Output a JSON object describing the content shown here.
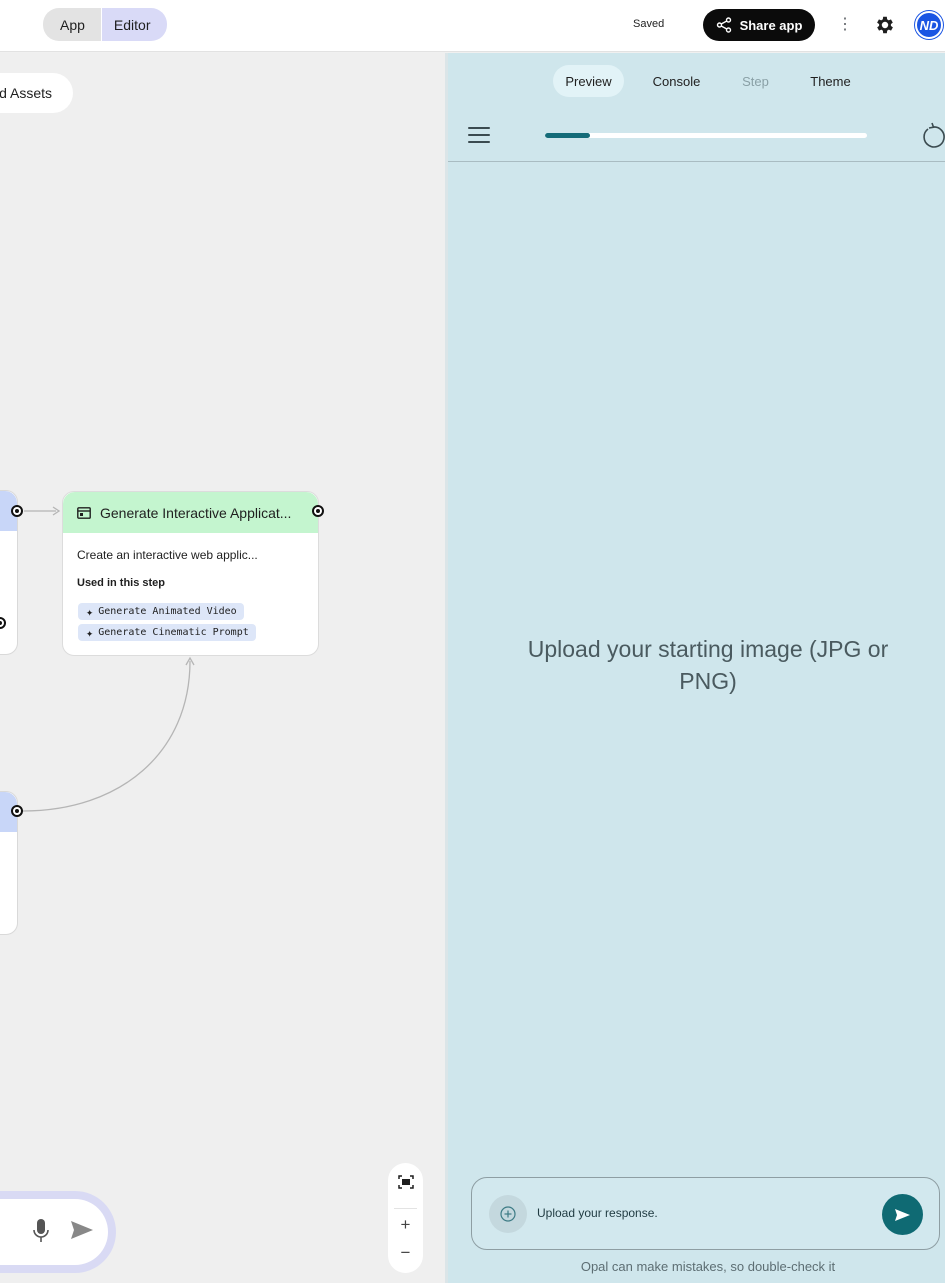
{
  "topbar": {
    "mode_app": "App",
    "mode_editor": "Editor",
    "saved_status": "Saved",
    "share_label": "Share app",
    "avatar_initials": "ND"
  },
  "canvas": {
    "assets_chip": "d Assets",
    "node": {
      "title": "Generate Interactive Applicat...",
      "description": "Create an interactive web applic...",
      "used_in_label": "Used in this step",
      "chips": [
        "Generate Animated Video",
        "Generate Cinematic Prompt"
      ],
      "header_color": "#c4f5cf"
    },
    "zoom": {
      "zoom_in": "+",
      "zoom_out": "−"
    }
  },
  "preview": {
    "tabs": [
      {
        "label": "Preview",
        "state": "active"
      },
      {
        "label": "Console",
        "state": "normal"
      },
      {
        "label": "Step",
        "state": "disabled"
      },
      {
        "label": "Theme",
        "state": "normal"
      }
    ],
    "progress_fraction": 0.14,
    "prompt": "Upload your starting image (JPG or PNG)",
    "input_placeholder": "Upload your response.",
    "disclaimer": "Opal can make mistakes, so double-check it",
    "accent_color": "#0f6a73"
  }
}
